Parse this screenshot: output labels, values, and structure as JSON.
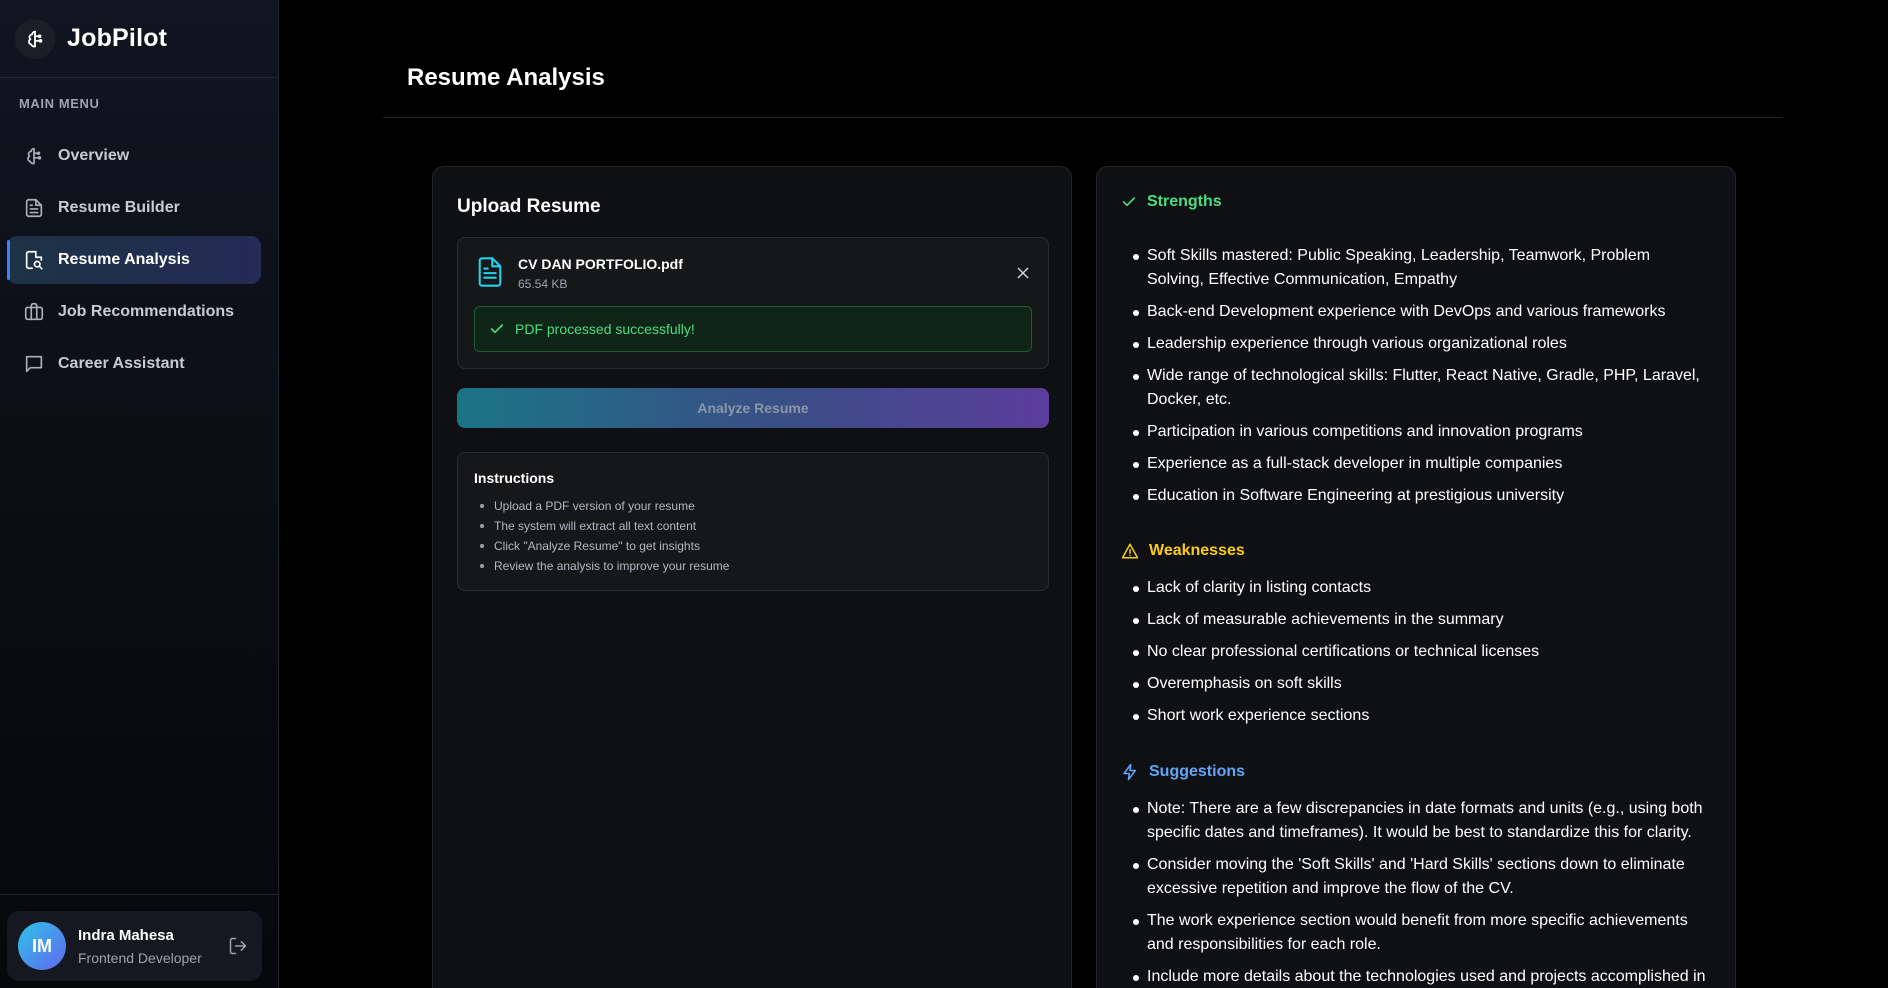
{
  "app": {
    "name": "JobPilot"
  },
  "sidebar": {
    "menu_label": "MAIN MENU",
    "items": [
      {
        "label": "Overview",
        "icon": "brain-icon",
        "active": false
      },
      {
        "label": "Resume Builder",
        "icon": "file-text-icon",
        "active": false
      },
      {
        "label": "Resume Analysis",
        "icon": "file-search-icon",
        "active": true
      },
      {
        "label": "Job Recommendations",
        "icon": "briefcase-icon",
        "active": false
      },
      {
        "label": "Career Assistant",
        "icon": "chat-icon",
        "active": false
      }
    ]
  },
  "user": {
    "initials": "IM",
    "name": "Indra Mahesa",
    "role": "Frontend Developer"
  },
  "page": {
    "title": "Resume Analysis"
  },
  "upload": {
    "title": "Upload Resume",
    "file_name": "CV DAN PORTFOLIO.pdf",
    "file_size": "65.54 KB",
    "success_message": "PDF processed successfully!",
    "analyze_label": "Analyze Resume",
    "instructions_title": "Instructions",
    "instructions": [
      "Upload a PDF version of your resume",
      "The system will extract all text content",
      "Click \"Analyze Resume\" to get insights",
      "Review the analysis to improve your resume"
    ]
  },
  "analysis": {
    "strengths_title": "Strengths",
    "strengths": [
      "Soft Skills mastered: Public Speaking, Leadership, Teamwork, Problem Solving, Effective Communication, Empathy",
      "Back-end Development experience with DevOps and various frameworks",
      "Leadership experience through various organizational roles",
      "Wide range of technological skills: Flutter, React Native, Gradle, PHP, Laravel, Docker, etc.",
      "Participation in various competitions and innovation programs",
      "Experience as a full-stack developer in multiple companies",
      "Education in Software Engineering at prestigious university"
    ],
    "weaknesses_title": "Weaknesses",
    "weaknesses": [
      "Lack of clarity in listing contacts",
      "Lack of measurable achievements in the summary",
      "No clear professional certifications or technical licenses",
      "Overemphasis on soft skills",
      "Short work experience sections"
    ],
    "suggestions_title": "Suggestions",
    "suggestions": [
      "Note: There are a few discrepancies in date formats and units (e.g., using both specific dates and timeframes). It would be best to standardize this for clarity.",
      "Consider moving the 'Soft Skills' and 'Hard Skills' sections down to eliminate excessive repetition and improve the flow of the CV.",
      "The work experience section would benefit from more specific achievements and responsibilities for each role.",
      "Include more details about the technologies used and projects accomplished in"
    ]
  },
  "colors": {
    "strengths": "#4ade80",
    "weaknesses": "#facc15",
    "suggestions": "#60a5fa",
    "accent": "#3b82f6"
  }
}
